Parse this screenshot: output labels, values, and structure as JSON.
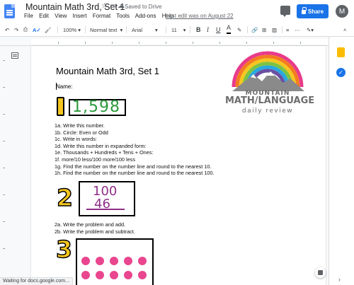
{
  "app": {
    "doc_title": "Mountain Math 3rd, Set 1",
    "saved_status": "Saved to Drive",
    "menu": [
      "File",
      "Edit",
      "View",
      "Insert",
      "Format",
      "Tools",
      "Add-ons",
      "Help"
    ],
    "last_edit": "Last edit was on August 22",
    "share_label": "Share",
    "avatar_letter": "M"
  },
  "toolbar": {
    "zoom": "100%",
    "style": "Normal text",
    "font": "Arial",
    "size": "11",
    "bold": "B",
    "italic": "I",
    "underline": "U",
    "text_color": "A"
  },
  "document": {
    "title": "Mountain Math 3rd, Set 1",
    "name_label": "Name:",
    "logo": {
      "line1": "MOUNTAIN",
      "line2": "MATH/LANGUAGE",
      "line3": "daily review"
    },
    "section1": {
      "number": "1",
      "value": "1,598",
      "lines": [
        "1a. Write this number.",
        "1b. Circle: Even or Odd",
        "1c. Write in words:",
        "1d. Write this number in expanded form:",
        "1e. Thousands + Hundreds + Tens + Ones:",
        "1f. more/10 less/100 more/100 less",
        "1g. Find the number on the number line and round to the nearest 10.",
        "1h. Find the number on the number line and round to the nearest 100."
      ]
    },
    "section2": {
      "number": "2",
      "top": "100",
      "bottom": "46",
      "lines": [
        "2a. Write the problem and add.",
        "2b. Write the problem and subtract."
      ]
    },
    "section3": {
      "number": "3"
    }
  },
  "status": {
    "text": "Waiting for docs.google.com..."
  },
  "colors": {
    "docs_blue": "#4285f4",
    "share_blue": "#1a73e8",
    "number_badge_yellow": "#f4c61f",
    "green_value": "#2e9a3c",
    "purple_value": "#8e2f87",
    "pink_dots": "#e9468f"
  }
}
